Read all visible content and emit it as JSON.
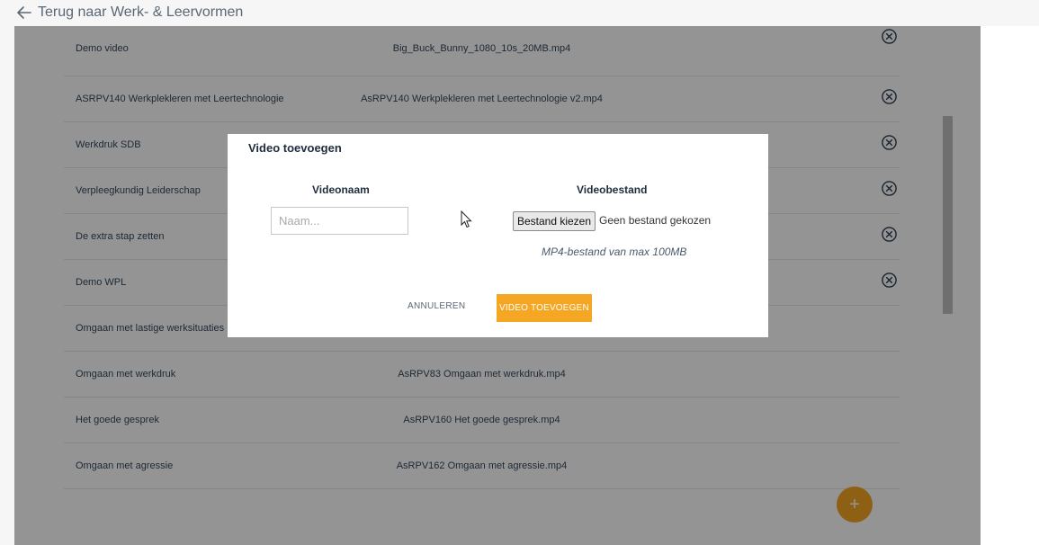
{
  "nav": {
    "back_label": "Terug naar Werk- & Leervormen"
  },
  "videos": [
    {
      "name": "Demo video",
      "file": "Big_Buck_Bunny_1080_10s_20MB.mp4",
      "deletable": true
    },
    {
      "name": "ASRPV140 Werkplekleren met Leertechnologie",
      "file": "AsRPV140 Werkplekleren met Leertechnologie v2.mp4",
      "deletable": true
    },
    {
      "name": "Werkdruk SDB",
      "file": "",
      "deletable": true
    },
    {
      "name": "Verpleegkundig Leiderschap",
      "file": "",
      "deletable": true
    },
    {
      "name": "De extra stap zetten",
      "file": "",
      "deletable": true
    },
    {
      "name": "Demo WPL",
      "file": "",
      "deletable": true
    },
    {
      "name": "Omgaan met lastige werksituaties",
      "file": "",
      "deletable": false
    },
    {
      "name": "Omgaan met werkdruk",
      "file": "AsRPV83 Omgaan met werkdruk.mp4",
      "deletable": false
    },
    {
      "name": "Het goede gesprek",
      "file": "AsRPV160 Het goede gesprek.mp4",
      "deletable": false
    },
    {
      "name": "Omgaan met agressie",
      "file": "AsRPV162 Omgaan met agressie.mp4",
      "deletable": false
    }
  ],
  "fab": {
    "label": "+"
  },
  "modal": {
    "title": "Video toevoegen",
    "name_heading": "Videonaam",
    "name_placeholder": "Naam...",
    "name_value": "",
    "file_heading": "Videobestand",
    "file_button": "Bestand kiezen",
    "file_status": "Geen bestand gekozen",
    "hint": "MP4-bestand van max 100MB",
    "cancel_label": "ANNULEREN",
    "submit_label": "VIDEO TOEVOEGEN"
  },
  "colors": {
    "accent": "#f5a623",
    "overlay": "rgba(0,0,0,0.42)",
    "text": "#34495e"
  },
  "icons": {
    "back": "arrow-left-icon",
    "delete": "close-circle-icon",
    "add": "plus-icon"
  }
}
